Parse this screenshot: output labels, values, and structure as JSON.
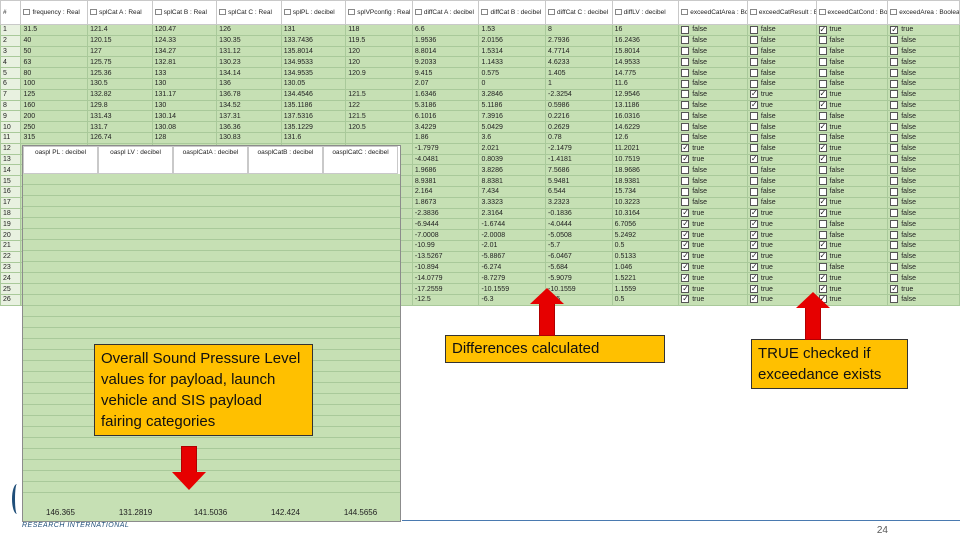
{
  "grid": {
    "headers": [
      "#",
      "frequency : Real",
      "splCat A : Real",
      "splCat B : Real",
      "splCat C : Real",
      "splPL : decibel",
      "splVPconfig : Real",
      "diffCat A : decibel",
      "diffCat B : decibel",
      "diffCat C : decibel",
      "diffLV : decibel",
      "exceedCatArea : Boolean",
      "exceedCatResult : Boolean",
      "exceedCatCond : Boolean",
      "exceedArea : Boolean"
    ],
    "rows": [
      [
        "1",
        "31.5",
        "121.4",
        "120.47",
        "126",
        "131",
        "118",
        "6.6",
        "1.53",
        "8",
        "16",
        "false",
        "false",
        "true",
        "true"
      ],
      [
        "2",
        "40",
        "120.15",
        "124.33",
        "130.35",
        "133.7436",
        "119.5",
        "1.9536",
        "2.0156",
        "2.7936",
        "16.2436",
        "false",
        "false",
        "false",
        "false"
      ],
      [
        "3",
        "50",
        "127",
        "134.27",
        "131.12",
        "135.8014",
        "120",
        "8.8014",
        "1.5314",
        "4.7714",
        "15.8014",
        "false",
        "false",
        "false",
        "false"
      ],
      [
        "4",
        "63",
        "125.75",
        "132.81",
        "130.23",
        "134.9533",
        "120",
        "9.2033",
        "1.1433",
        "4.6233",
        "14.9533",
        "false",
        "false",
        "false",
        "false"
      ],
      [
        "5",
        "80",
        "125.36",
        "133",
        "134.14",
        "134.9535",
        "120.9",
        "9.415",
        "0.575",
        "1.405",
        "14.775",
        "false",
        "false",
        "false",
        "false"
      ],
      [
        "6",
        "100",
        "130.5",
        "130",
        "136",
        "130.05",
        "",
        "2.07",
        "0",
        "1",
        "11.6",
        "false",
        "false",
        "false",
        "false"
      ],
      [
        "7",
        "125",
        "132.82",
        "131.17",
        "136.78",
        "134.4546",
        "121.5",
        "1.6346",
        "3.2846",
        "-2.3254",
        "12.9546",
        "false",
        "true",
        "true",
        "false"
      ],
      [
        "8",
        "160",
        "129.8",
        "130",
        "134.52",
        "135.1186",
        "122",
        "5.3186",
        "5.1186",
        "0.5986",
        "13.1186",
        "false",
        "true",
        "true",
        "false"
      ],
      [
        "9",
        "200",
        "131.43",
        "130.14",
        "137.31",
        "137.5316",
        "121.5",
        "6.1016",
        "7.3916",
        "0.2216",
        "16.0316",
        "false",
        "false",
        "false",
        "false"
      ],
      [
        "10",
        "250",
        "131.7",
        "130.08",
        "136.36",
        "135.1229",
        "120.5",
        "3.4229",
        "5.0429",
        "0.2629",
        "14.6229",
        "false",
        "false",
        "true",
        "false"
      ],
      [
        "11",
        "315",
        "126.74",
        "128",
        "130.83",
        "131.6",
        "",
        "1.86",
        "3.6",
        "0.78",
        "12.6",
        "false",
        "false",
        "false",
        "false"
      ],
      [
        "12",
        "",
        "",
        "",
        "",
        "",
        "",
        "-1.7979",
        "2.021",
        "-2.1479",
        "11.2021",
        "true",
        "false",
        "true",
        "false"
      ],
      [
        "13",
        "",
        "",
        "",
        "",
        "",
        "",
        "-4.0481",
        "0.8039",
        "-1.4181",
        "10.7519",
        "true",
        "true",
        "true",
        "false"
      ],
      [
        "14",
        "",
        "",
        "",
        "",
        "",
        "",
        "1.9686",
        "3.8286",
        "7.5686",
        "18.9686",
        "false",
        "false",
        "false",
        "false"
      ],
      [
        "15",
        "",
        "",
        "",
        "",
        "",
        "",
        "8.9381",
        "8.8381",
        "5.9481",
        "18.9381",
        "false",
        "false",
        "false",
        "false"
      ],
      [
        "16",
        "",
        "",
        "",
        "",
        "",
        "",
        "2.164",
        "7.434",
        "6.544",
        "15.734",
        "false",
        "false",
        "false",
        "false"
      ],
      [
        "17",
        "",
        "",
        "",
        "",
        "",
        "",
        "1.8673",
        "3.3323",
        "3.2323",
        "10.3223",
        "false",
        "false",
        "true",
        "false"
      ],
      [
        "18",
        "",
        "",
        "",
        "",
        "",
        "",
        "-2.3836",
        "2.3164",
        "-0.1836",
        "10.3164",
        "true",
        "true",
        "true",
        "false"
      ],
      [
        "19",
        "",
        "",
        "",
        "",
        "",
        "",
        "-6.9444",
        "-1.6744",
        "-4.0444",
        "6.7056",
        "true",
        "true",
        "false",
        "false"
      ],
      [
        "20",
        "",
        "",
        "",
        "",
        "",
        "",
        "-7.0008",
        "-2.0008",
        "-5.0508",
        "5.2492",
        "true",
        "true",
        "false",
        "false"
      ],
      [
        "21",
        "",
        "",
        "",
        "",
        "",
        "",
        "-10.99",
        "-2.01",
        "-5.7",
        "0.5",
        "true",
        "true",
        "true",
        "false"
      ],
      [
        "22",
        "",
        "",
        "",
        "",
        "",
        "",
        "-13.5267",
        "-5.8867",
        "-6.0467",
        "0.5133",
        "true",
        "true",
        "true",
        "false"
      ],
      [
        "23",
        "",
        "",
        "",
        "",
        "",
        "",
        "-10.894",
        "-6.274",
        "-5.684",
        "1.046",
        "true",
        "true",
        "false",
        "false"
      ],
      [
        "24",
        "",
        "",
        "",
        "",
        "",
        "",
        "-14.0779",
        "-8.7279",
        "-5.9079",
        "1.5221",
        "true",
        "true",
        "true",
        "false"
      ],
      [
        "25",
        "",
        "",
        "",
        "",
        "",
        "",
        "-17.2559",
        "-10.1559",
        "-10.1559",
        "1.1559",
        "true",
        "true",
        "true",
        "true"
      ],
      [
        "26",
        "",
        "",
        "",
        "",
        "",
        "",
        "-12.5",
        "-6.3",
        "-2.5",
        "0.5",
        "true",
        "true",
        "true",
        "false"
      ]
    ]
  },
  "overlay": {
    "headers": [
      "oaspl PL : decibel",
      "oaspl LV : decibel",
      "oasplCatA : decibel",
      "oasplCatB : decibel",
      "oasplCatC : decibel"
    ],
    "values": [
      "146.365",
      "131.2819",
      "141.5036",
      "142.424",
      "144.5656"
    ]
  },
  "callouts": {
    "oaspl": "Overall Sound Pressure Level values for payload, launch vehicle and SIS payload fairing categories",
    "differences": "Differences calculated",
    "exceed": "TRUE checked if exceedance exists"
  },
  "footer": {
    "logo_text": "RESEARCH INTERNATIONAL",
    "page_number": "24"
  },
  "colors": {
    "grid_bg": "#c6e0b4",
    "callout_bg": "#ffc000",
    "arrow": "#e60000"
  }
}
